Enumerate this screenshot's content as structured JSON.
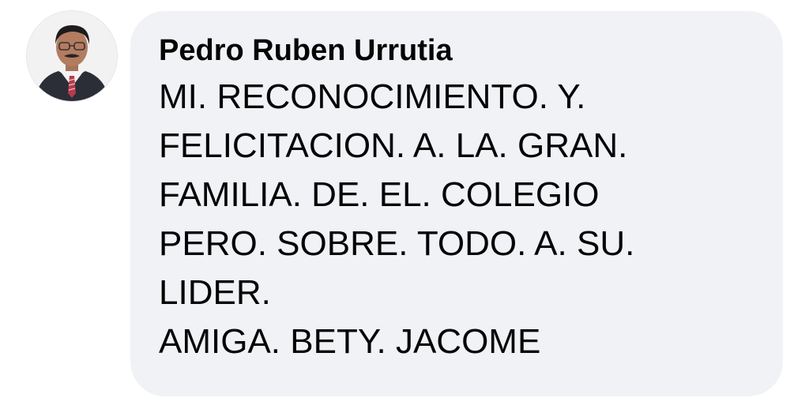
{
  "comment": {
    "author": "Pedro Ruben Urrutia",
    "avatar_icon": "profile-photo",
    "lines": [
      "MI. RECONOCIMIENTO. Y.",
      "FELICITACION. A. LA. GRAN.",
      "FAMILIA. DE. EL. COLEGIO",
      "PERO. SOBRE. TODO. A. SU.",
      "LIDER.",
      "AMIGA. BETY. JACOME"
    ]
  },
  "colors": {
    "bubble_background": "#f0f2f5",
    "text": "#050505"
  }
}
